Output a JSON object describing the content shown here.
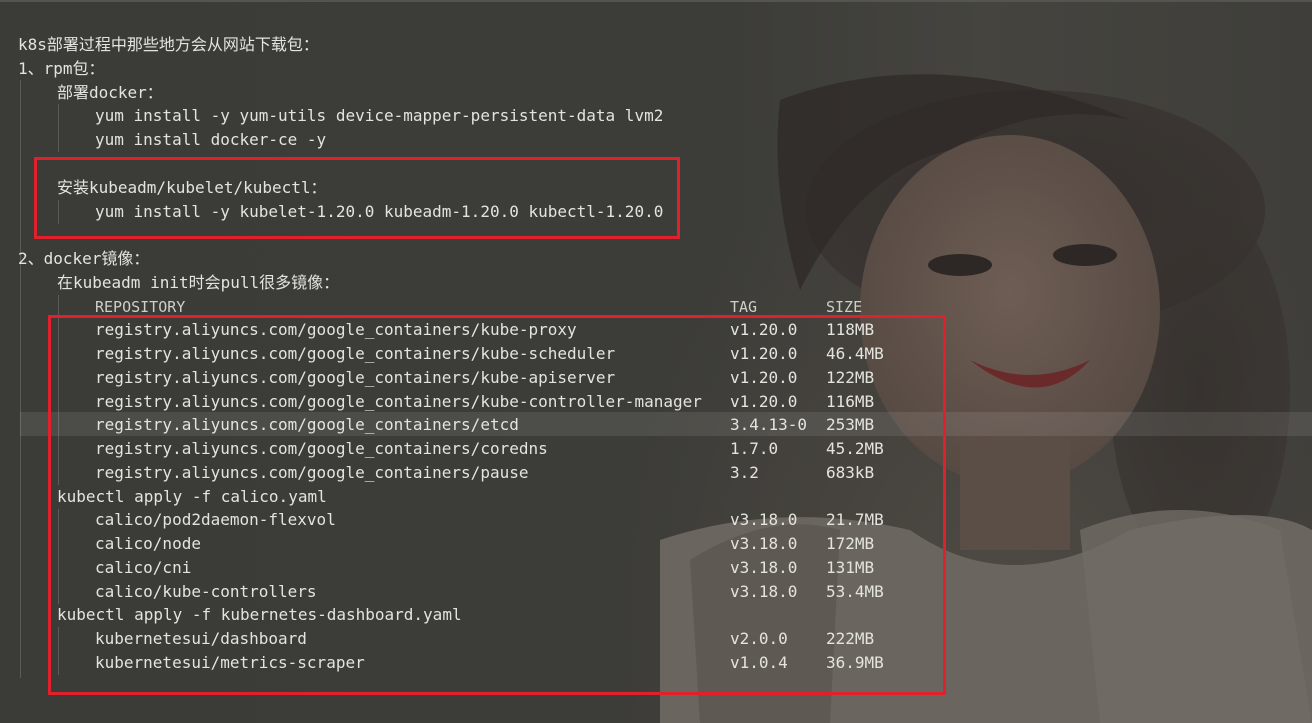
{
  "title": "k8s部署过程中那些地方会从网站下载包：",
  "section1": {
    "heading": "1、rpm包：",
    "docker_label": "部署docker：",
    "docker_cmd1": "yum install -y yum-utils device-mapper-persistent-data lvm2",
    "docker_cmd2": "yum install docker-ce -y",
    "kube_label": "安装kubeadm/kubelet/kubectl：",
    "kube_cmd": "yum install -y kubelet-1.20.0 kubeadm-1.20.0 kubectl-1.20.0"
  },
  "section2": {
    "heading": "2、docker镜像：",
    "init_label": "在kubeadm init时会pull很多镜像：",
    "columns": {
      "repository": "REPOSITORY",
      "tag": "TAG",
      "size": "SIZE"
    },
    "init_images": [
      {
        "repo": "registry.aliyuncs.com/google_containers/kube-proxy",
        "tag": "v1.20.0",
        "size": "118MB"
      },
      {
        "repo": "registry.aliyuncs.com/google_containers/kube-scheduler",
        "tag": "v1.20.0",
        "size": "46.4MB"
      },
      {
        "repo": "registry.aliyuncs.com/google_containers/kube-apiserver",
        "tag": "v1.20.0",
        "size": "122MB"
      },
      {
        "repo": "registry.aliyuncs.com/google_containers/kube-controller-manager",
        "tag": "v1.20.0",
        "size": "116MB"
      },
      {
        "repo": "registry.aliyuncs.com/google_containers/etcd",
        "tag": "3.4.13-0",
        "size": "253MB"
      },
      {
        "repo": "registry.aliyuncs.com/google_containers/coredns",
        "tag": "1.7.0",
        "size": "45.2MB"
      },
      {
        "repo": "registry.aliyuncs.com/google_containers/pause",
        "tag": "3.2",
        "size": "683kB"
      }
    ],
    "calico_cmd": "kubectl apply -f calico.yaml",
    "calico_images": [
      {
        "repo": "calico/pod2daemon-flexvol",
        "tag": "v3.18.0",
        "size": "21.7MB"
      },
      {
        "repo": "calico/node",
        "tag": "v3.18.0",
        "size": "172MB"
      },
      {
        "repo": "calico/cni",
        "tag": "v3.18.0",
        "size": "131MB"
      },
      {
        "repo": "calico/kube-controllers",
        "tag": "v3.18.0",
        "size": "53.4MB"
      }
    ],
    "dashboard_cmd": "kubectl apply -f kubernetes-dashboard.yaml",
    "dashboard_images": [
      {
        "repo": "kubernetesui/dashboard",
        "tag": "v2.0.0",
        "size": "222MB"
      },
      {
        "repo": "kubernetesui/metrics-scraper",
        "tag": "v1.0.4",
        "size": "36.9MB"
      }
    ]
  },
  "colors": {
    "highlight_box": "#e0202a",
    "text": "#e4e4df",
    "background": "#3a3a36"
  }
}
